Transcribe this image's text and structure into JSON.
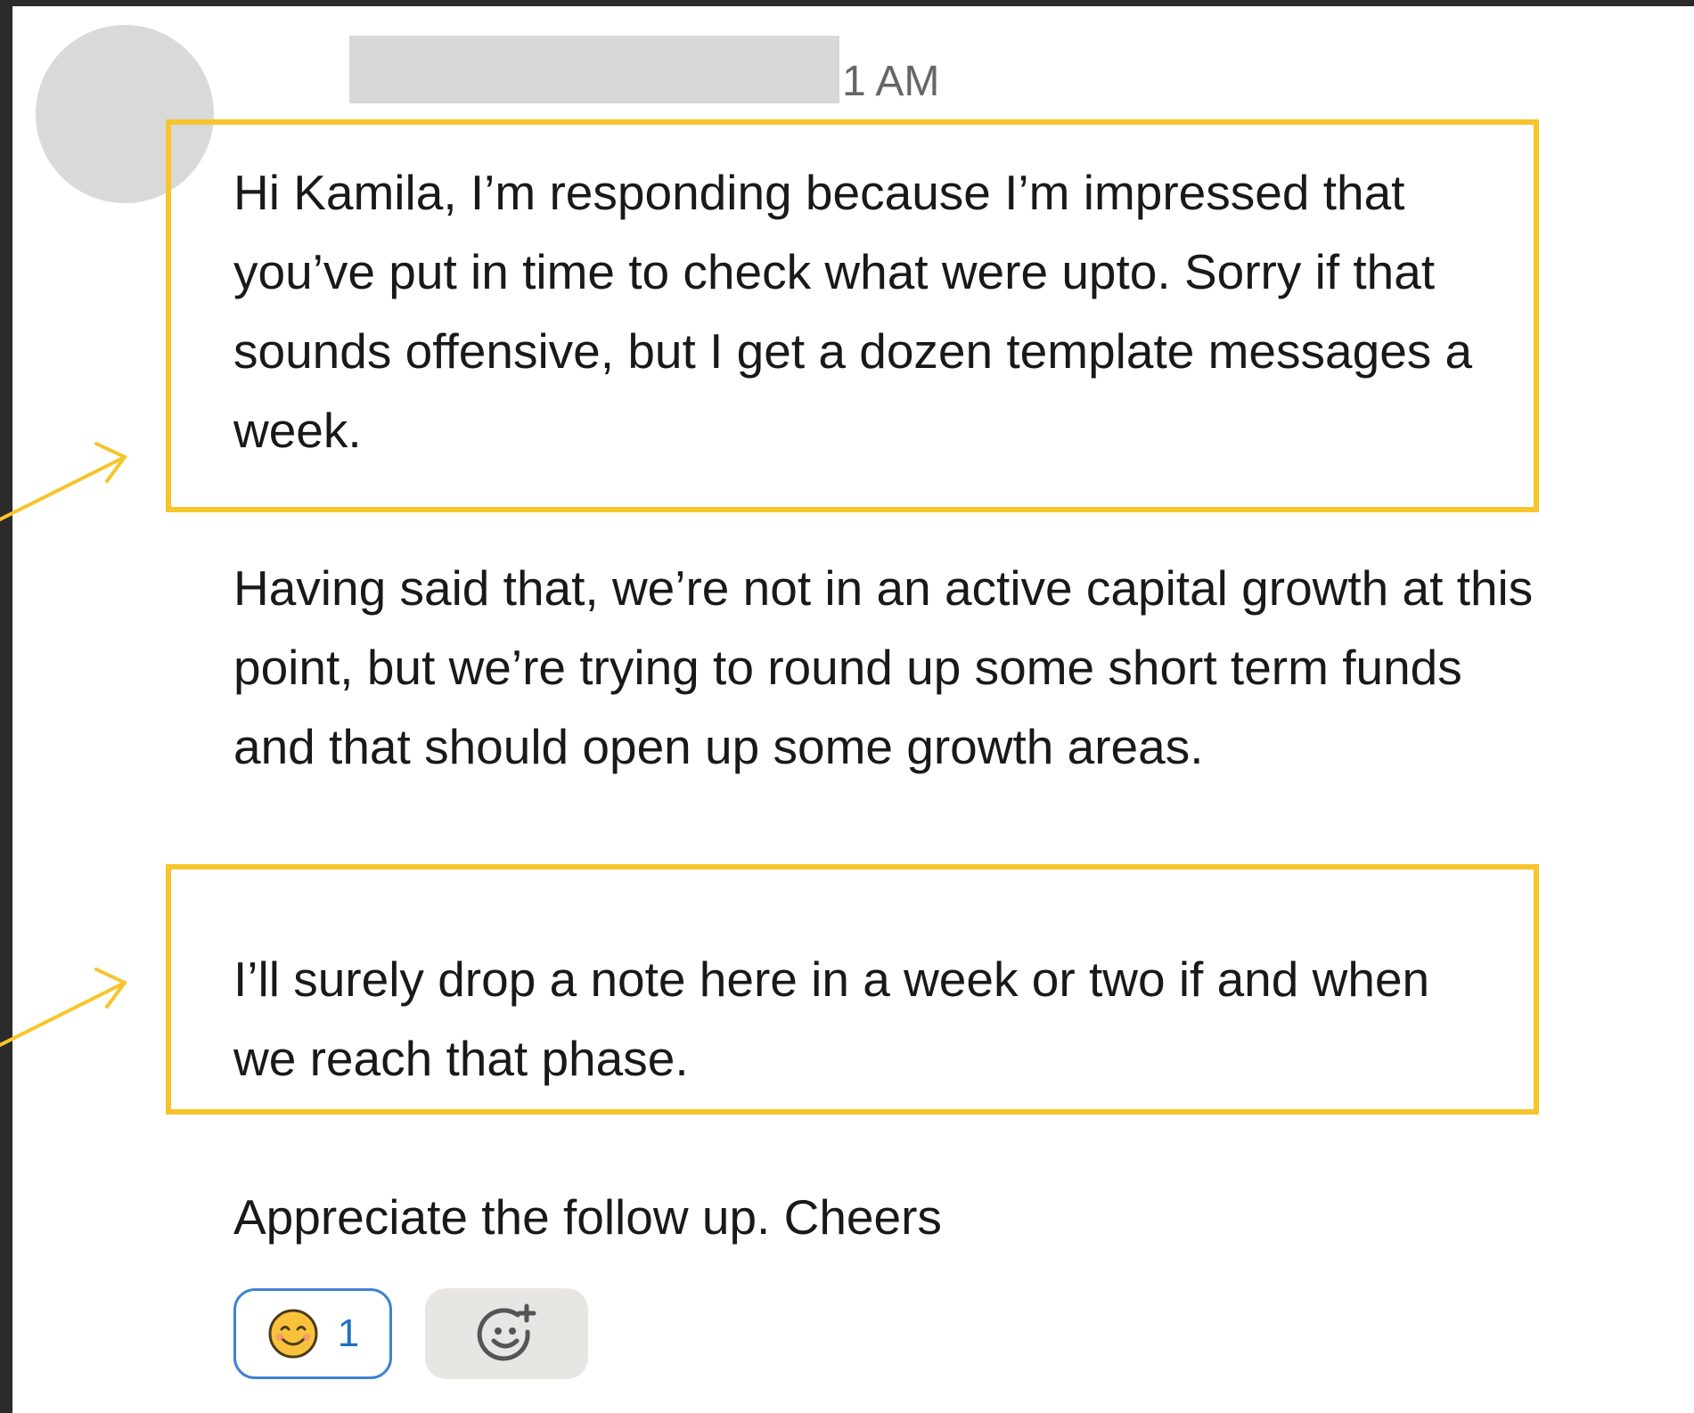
{
  "message": {
    "timestamp": "1 AM",
    "paragraphs": [
      "Hi Kamila, I’m responding because I’m impressed that you’ve put in time to check what were upto. Sorry if that sounds offensive, but I get a dozen template messages a week.",
      "Having said that, we’re not in an active capital growth at this point, but we’re trying to round up some short term funds and that should open up some growth areas.",
      "I’ll surely drop a note here in a week or two if and when we reach that phase.",
      "Appreciate the follow up. Cheers"
    ]
  },
  "reactions": {
    "items": [
      {
        "icon": "smiling-face-icon",
        "count": "1"
      }
    ],
    "add_icon": "add-reaction-icon"
  },
  "annotations": {
    "highlight_color": "#f7c52b"
  },
  "colors": {
    "reaction_border": "#3f82d1",
    "reaction_count": "#1f6fc4",
    "avatar_placeholder": "#d9d9d9"
  }
}
